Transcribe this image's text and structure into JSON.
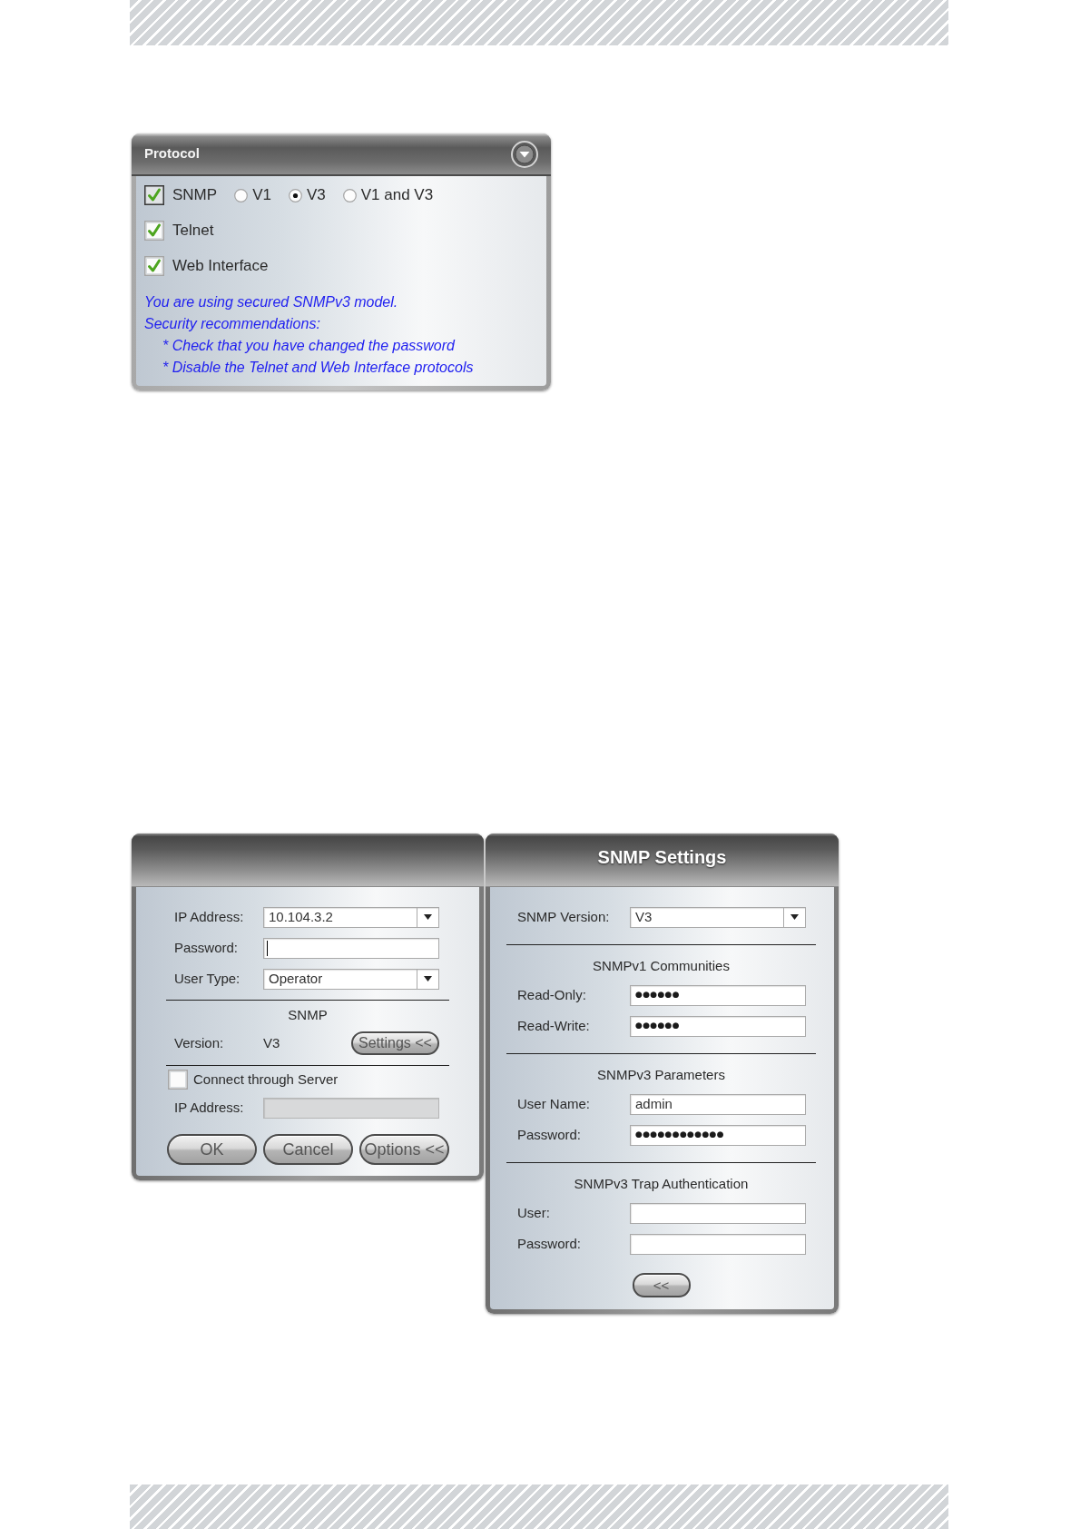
{
  "protocol_panel": {
    "title": "Protocol",
    "protocols": [
      {
        "label": "SNMP",
        "checked": true,
        "focused": true,
        "versions": [
          {
            "label": "V1",
            "selected": false
          },
          {
            "label": "V3",
            "selected": true
          },
          {
            "label": "V1 and V3",
            "selected": false
          }
        ]
      },
      {
        "label": "Telnet",
        "checked": true,
        "focused": false
      },
      {
        "label": "Web Interface",
        "checked": true,
        "focused": false
      }
    ],
    "notes": {
      "summary": "You are using secured SNMPv3 model.",
      "heading": "Security recommendations:",
      "items": [
        "* Check that you have changed the password",
        "* Disable the Telnet and Web Interface protocols"
      ]
    }
  },
  "login_panel": {
    "fields": [
      {
        "kind": "combo",
        "label": "IP Address:",
        "value": "10.104.3.2",
        "focused": false
      },
      {
        "kind": "text",
        "label": "Password:",
        "focused": true
      },
      {
        "kind": "combo",
        "label": "User Type:",
        "value": "Operator",
        "focused": false
      }
    ],
    "snmp": {
      "heading": "SNMP",
      "version_label": "Version:",
      "version": "V3",
      "settings_button": "Settings <<"
    },
    "server": {
      "label": "Connect through Server",
      "checked": false,
      "ip_label": "IP Address:",
      "disabled": true
    },
    "buttons": [
      "OK",
      "Cancel",
      "Options <<"
    ]
  },
  "snmp_settings_panel": {
    "title": "SNMP Settings",
    "version": {
      "label": "SNMP Version:",
      "value": "V3"
    },
    "sections": [
      {
        "heading": "SNMPv1 Communities",
        "fields": [
          {
            "label": "Read-Only:",
            "value": "●●●●●●"
          },
          {
            "label": "Read-Write:",
            "value": "●●●●●●"
          }
        ]
      },
      {
        "heading": "SNMPv3 Parameters",
        "fields": [
          {
            "label": "User Name:",
            "value": "admin"
          },
          {
            "label": "Password:",
            "value": "●●●●●●●●●●●●"
          }
        ]
      },
      {
        "heading": "SNMPv3 Trap Authentication",
        "fields": [
          {
            "label": "User:"
          },
          {
            "label": "Password:"
          }
        ]
      }
    ],
    "back_button": "<<"
  }
}
